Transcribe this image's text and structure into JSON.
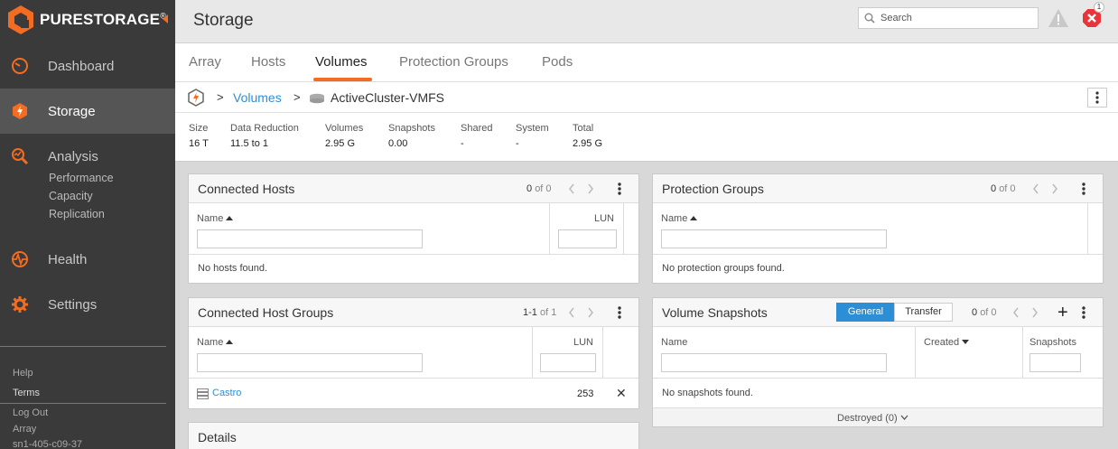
{
  "brand": {
    "name": "PURESTORAGE",
    "registered": "®",
    "accent": "#f26d21"
  },
  "sidebar": {
    "items": [
      {
        "label": "Dashboard",
        "icon": "dashboard-icon"
      },
      {
        "label": "Storage",
        "icon": "storage-icon",
        "active": true
      },
      {
        "label": "Analysis",
        "icon": "analysis-icon"
      },
      {
        "label": "Health",
        "icon": "health-icon"
      },
      {
        "label": "Settings",
        "icon": "settings-icon"
      }
    ],
    "analysis_sub": [
      "Performance",
      "Capacity",
      "Replication"
    ],
    "footer_links": [
      "Help",
      "Terms",
      "Log Out"
    ],
    "array_label": "Array",
    "array_name": "sn1-405-c09-37"
  },
  "header": {
    "title": "Storage",
    "search_placeholder": "Search",
    "alert_count": "1"
  },
  "tabs": [
    "Array",
    "Hosts",
    "Volumes",
    "Protection Groups",
    "Pods"
  ],
  "active_tab": "Volumes",
  "breadcrumb": {
    "sep": ">",
    "link": "Volumes",
    "current": "ActiveCluster-VMFS"
  },
  "stats": [
    {
      "label": "Size",
      "value": "16 T"
    },
    {
      "label": "Data Reduction",
      "value": "11.5 to 1"
    },
    {
      "label": "Volumes",
      "value": "2.95 G"
    },
    {
      "label": "Snapshots",
      "value": "0.00"
    },
    {
      "label": "Shared",
      "value": "-"
    },
    {
      "label": "System",
      "value": "-"
    },
    {
      "label": "Total",
      "value": "2.95 G"
    }
  ],
  "connected_hosts": {
    "title": "Connected Hosts",
    "pager_count": "0",
    "pager_of": "of 0",
    "col_name": "Name",
    "col_lun": "LUN",
    "empty": "No hosts found."
  },
  "protection_groups": {
    "title": "Protection Groups",
    "pager_count": "0",
    "pager_of": "of 0",
    "col_name": "Name",
    "empty": "No protection groups found."
  },
  "connected_host_groups": {
    "title": "Connected Host Groups",
    "pager_count": "1-1",
    "pager_of": "of 1",
    "col_name": "Name",
    "col_lun": "LUN",
    "rows": [
      {
        "name": "Castro",
        "lun": "253",
        "remove": "✕"
      }
    ]
  },
  "volume_snapshots": {
    "title": "Volume Snapshots",
    "toggle_general": "General",
    "toggle_transfer": "Transfer",
    "pager_count": "0",
    "pager_of": "of 0",
    "add": "+",
    "col_name": "Name",
    "col_created": "Created",
    "col_snapshots": "Snapshots",
    "empty": "No snapshots found.",
    "destroyed": "Destroyed (0)"
  },
  "details": {
    "title": "Details"
  }
}
